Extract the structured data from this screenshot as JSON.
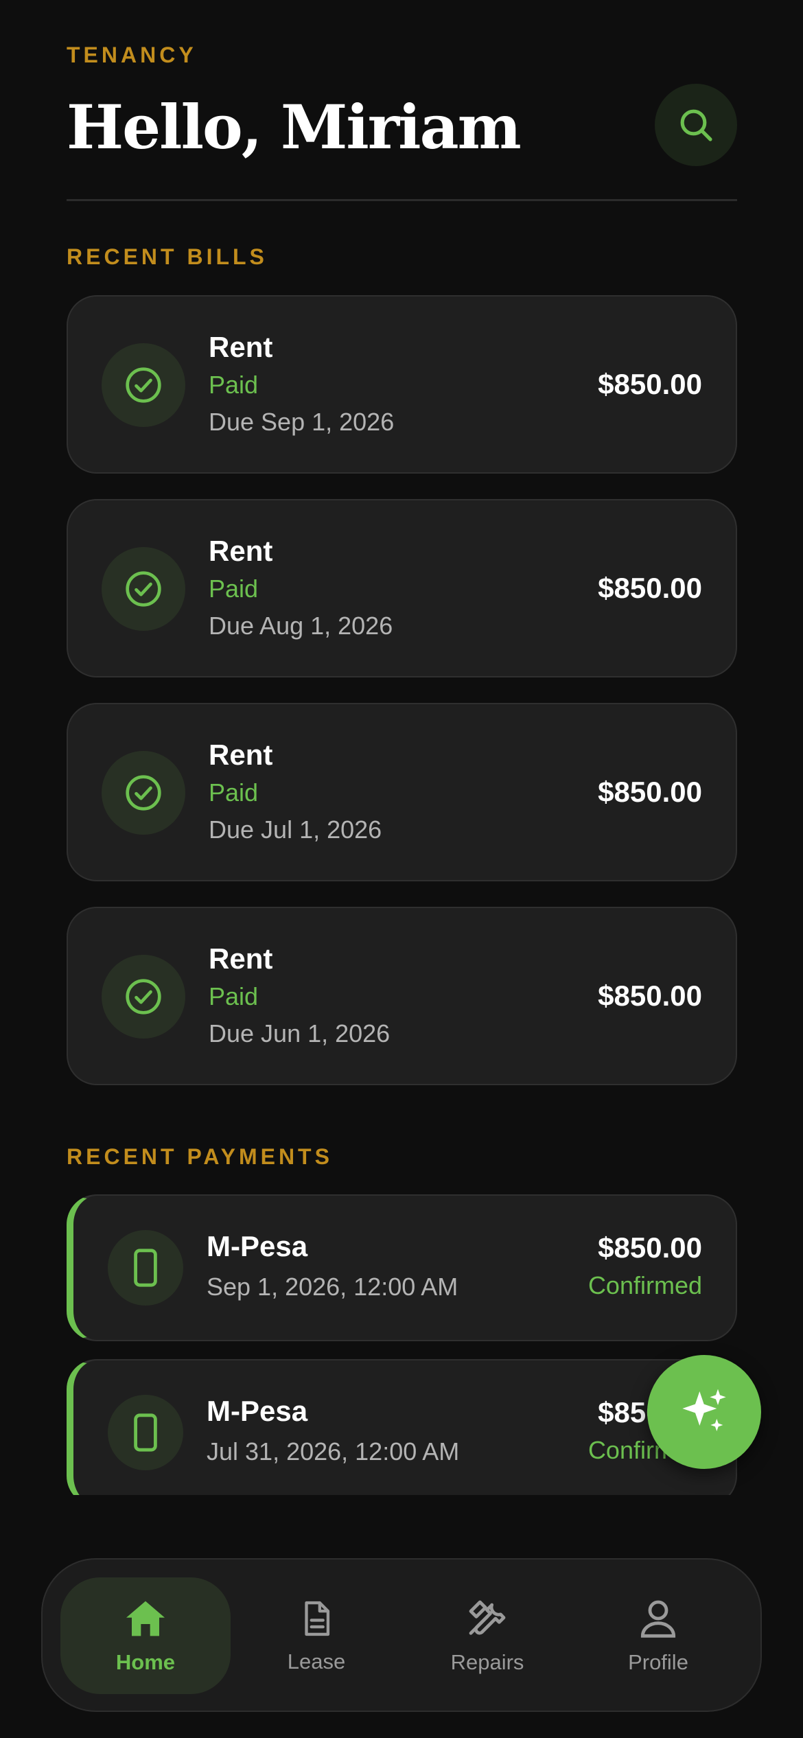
{
  "header": {
    "eyebrow": "TENANCY",
    "greeting": "Hello, Miriam"
  },
  "bills": {
    "section_label": "RECENT BILLS",
    "items": [
      {
        "title": "Rent",
        "status": "Paid",
        "due": "Due Sep 1, 2026",
        "amount": "$850.00"
      },
      {
        "title": "Rent",
        "status": "Paid",
        "due": "Due Aug 1, 2026",
        "amount": "$850.00"
      },
      {
        "title": "Rent",
        "status": "Paid",
        "due": "Due Jul 1, 2026",
        "amount": "$850.00"
      },
      {
        "title": "Rent",
        "status": "Paid",
        "due": "Due Jun 1, 2026",
        "amount": "$850.00"
      }
    ]
  },
  "payments": {
    "section_label": "RECENT PAYMENTS",
    "items": [
      {
        "method": "M-Pesa",
        "date": "Sep 1, 2026, 12:00 AM",
        "amount": "$850.00",
        "status": "Confirmed"
      },
      {
        "method": "M-Pesa",
        "date": "Jul 31, 2026, 12:00 AM",
        "amount": "$850.00",
        "status": "Confirmed"
      }
    ]
  },
  "nav": {
    "items": [
      {
        "label": "Home",
        "icon": "home-icon",
        "active": true
      },
      {
        "label": "Lease",
        "icon": "document-icon",
        "active": false
      },
      {
        "label": "Repairs",
        "icon": "tools-icon",
        "active": false
      },
      {
        "label": "Profile",
        "icon": "user-icon",
        "active": false
      }
    ]
  },
  "colors": {
    "accent_green": "#6cc04f",
    "label_gold": "#c28d1d",
    "background": "#0e0e0e",
    "card": "#1f1f1f"
  }
}
